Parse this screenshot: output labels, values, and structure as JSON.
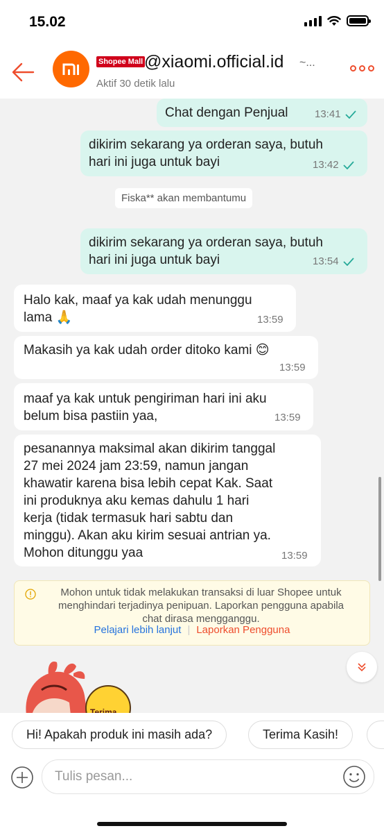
{
  "status_bar": {
    "time": "15.02"
  },
  "header": {
    "mall_badge": "Shopee Mall",
    "shop_name": "@xiaomi.official.id",
    "shop_extra": "~...",
    "active_status": "Aktif  30 detik lalu",
    "accent_color": "#ee4d2d"
  },
  "messages": [
    {
      "dir": "out",
      "text": "Chat dengan Penjual",
      "time": "13:41"
    },
    {
      "dir": "out",
      "line1": "dikirim sekarang ya orderan saya, butuh",
      "line2": "hari ini juga untuk bayi",
      "time": "13:42"
    },
    {
      "dir": "system",
      "text": "Fiska** akan membantumu"
    },
    {
      "dir": "out",
      "line1": "dikirim sekarang ya orderan saya, butuh",
      "line2": "hari ini juga untuk bayi",
      "time": "13:54"
    },
    {
      "dir": "in",
      "line1": "Halo kak, maaf ya kak udah menunggu",
      "line2": "lama 🙏",
      "time": "13:59"
    },
    {
      "dir": "in",
      "text": "Makasih ya kak udah order ditoko kami 😊",
      "time": "13:59"
    },
    {
      "dir": "in",
      "line1": "maaf ya kak untuk pengiriman hari ini aku",
      "line2": "belum  bisa pastiin yaa,",
      "time": "13:59"
    },
    {
      "dir": "in",
      "lines": [
        "pesanannya maksimal akan dikirim tanggal",
        "27 mei 2024 jam 23:59, namun jangan",
        "khawatir karena bisa lebih cepat Kak. Saat",
        "ini produknya aku kemas dahulu 1 hari",
        "kerja (tidak termasuk hari sabtu dan",
        "minggu). Akan aku kirim sesuai antrian ya.",
        "Mohon ditunggu yaa"
      ],
      "time": "13:59"
    }
  ],
  "warning": {
    "line1": "Mohon untuk tidak melakukan transaksi di luar Shopee untuk",
    "line2": "menghindari terjadinya penipuan. Laporkan pengguna apabila",
    "line3": "chat dirasa mengganggu.",
    "learn_more": "Pelajari lebih lanjut",
    "report": "Laporkan Pengguna"
  },
  "sticker": {
    "text": "Terima"
  },
  "quick_replies": [
    "Hi! Apakah produk ini masih ada?",
    "Terima Kasih!"
  ],
  "input": {
    "placeholder": "Tulis pesan..."
  }
}
